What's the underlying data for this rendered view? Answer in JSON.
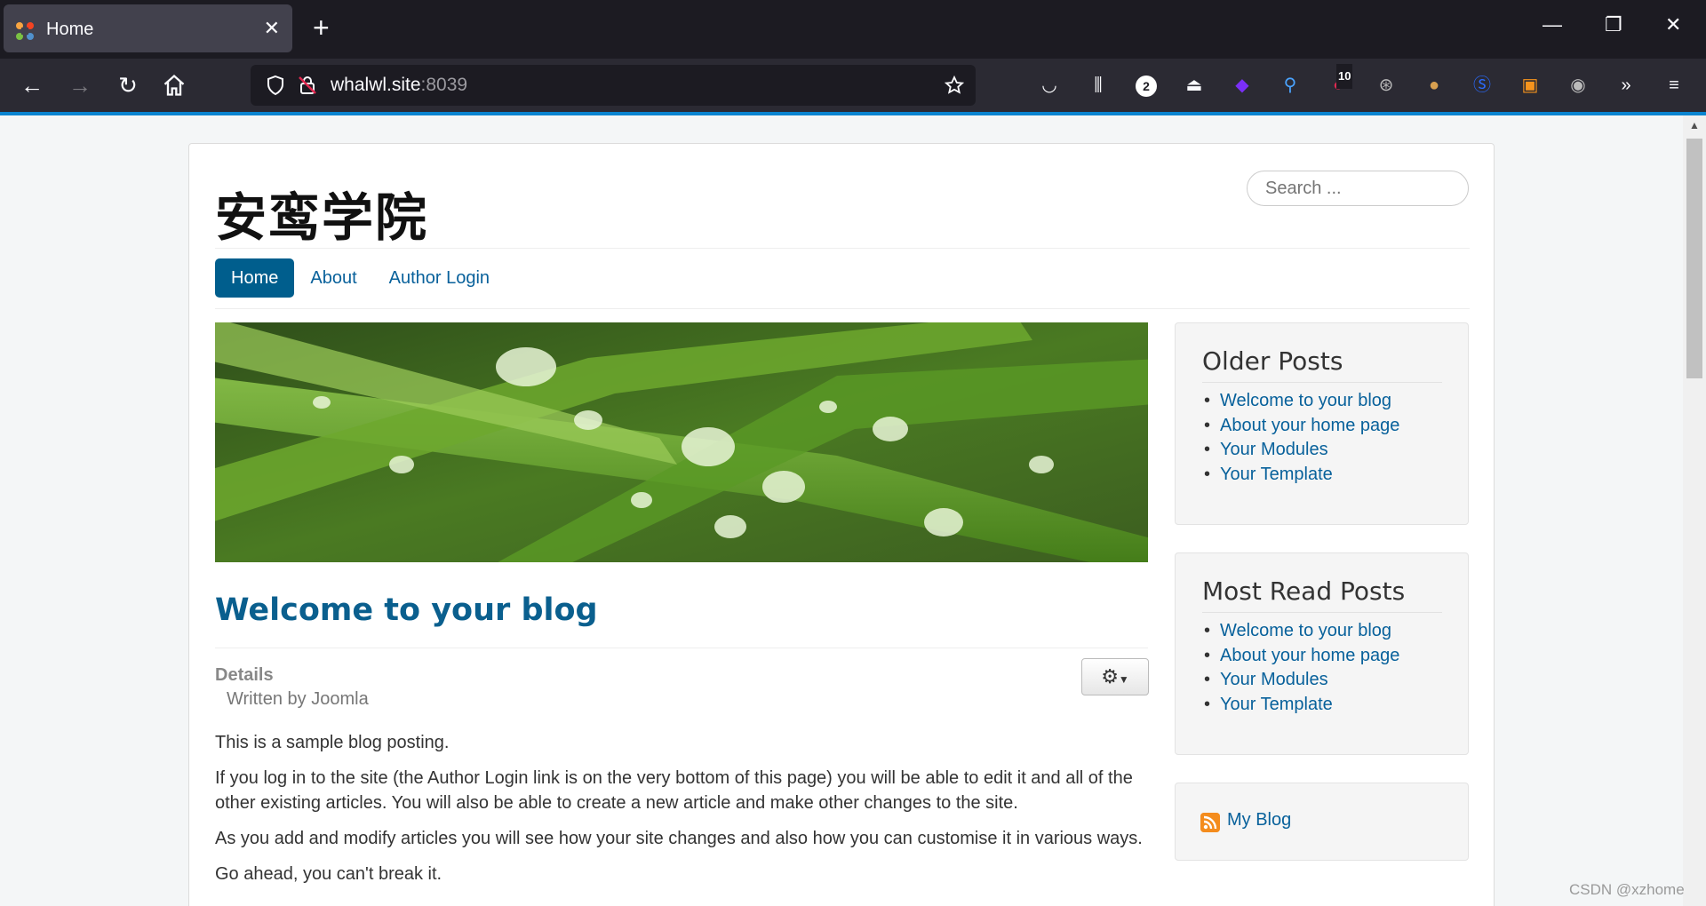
{
  "browser": {
    "tab_title": "Home",
    "url_host": "whalwl.site",
    "url_port": ":8039",
    "badges": {
      "notifications": "2",
      "extension_count": "10"
    }
  },
  "site": {
    "brand": "安鸾学院",
    "search_placeholder": "Search ...",
    "menu": [
      {
        "label": "Home",
        "active": true
      },
      {
        "label": "About",
        "active": false
      },
      {
        "label": "Author Login",
        "active": false
      }
    ]
  },
  "article": {
    "title": "Welcome to your blog",
    "details_label": "Details",
    "author": "Written by Joomla",
    "paragraphs": [
      "This is a sample blog posting.",
      "If you log in to the site (the Author Login link is on the very bottom of this page) you will be able to edit it and all of the other existing articles. You will also be able to create a new article and make other changes to the site.",
      "As you add and modify articles you will see how your site changes and also how you can customise it in various ways.",
      "Go ahead, you can't break it."
    ]
  },
  "sidebar": {
    "older_posts": {
      "title": "Older Posts",
      "items": [
        "Welcome to your blog",
        "About your home page",
        "Your Modules",
        "Your Template"
      ]
    },
    "most_read": {
      "title": "Most Read Posts",
      "items": [
        "Welcome to your blog",
        "About your home page",
        "Your Modules",
        "Your Template"
      ]
    },
    "feed": {
      "label": "My Blog"
    }
  },
  "watermark": "CSDN @xzhome",
  "colors": {
    "accent": "#005e8d",
    "link": "#08619b",
    "chrome_dark": "#1c1b22",
    "chrome_toolbar": "#2b2a33",
    "progress": "#0a84d0"
  }
}
